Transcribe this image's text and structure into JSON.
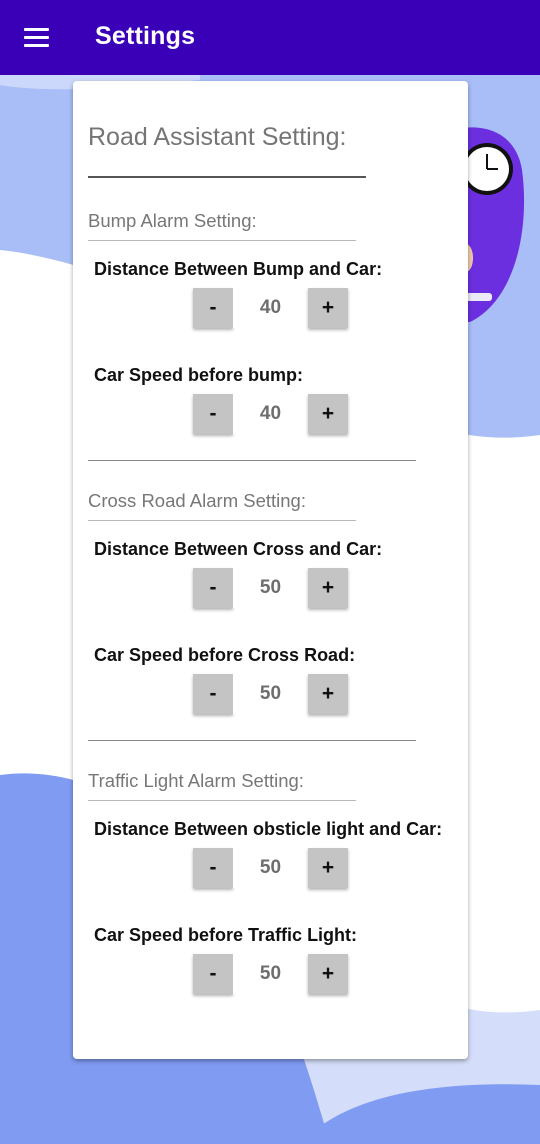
{
  "appbar": {
    "menu_icon": "hamburger-menu-icon",
    "title": "Settings",
    "color": "#3a00b8"
  },
  "card": {
    "title": "Road Assistant Setting:",
    "sections": [
      {
        "title": "Bump Alarm Setting:",
        "fields": [
          {
            "label": "Distance Between Bump and Car:",
            "minus": "-",
            "value": "40",
            "plus": "+"
          },
          {
            "label": "Car Speed before bump:",
            "minus": "-",
            "value": "40",
            "plus": "+"
          }
        ]
      },
      {
        "title": "Cross Road Alarm Setting:",
        "fields": [
          {
            "label": "Distance Between Cross and Car:",
            "minus": "-",
            "value": "50",
            "plus": "+"
          },
          {
            "label": "Car Speed before Cross Road:",
            "minus": "-",
            "value": "50",
            "plus": "+"
          }
        ]
      },
      {
        "title": "Traffic Light Alarm Setting:",
        "fields": [
          {
            "label": "Distance Between obsticle light and Car:",
            "minus": "-",
            "value": "50",
            "plus": "+"
          },
          {
            "label": "Car Speed before Traffic Light:",
            "minus": "-",
            "value": "50",
            "plus": "+"
          }
        ]
      }
    ]
  },
  "background": {
    "colors": {
      "light_blue": "#a9bdf7",
      "mid_blue": "#7f9bf2",
      "purple": "#6b2fe0",
      "pale": "#d4defa"
    }
  }
}
